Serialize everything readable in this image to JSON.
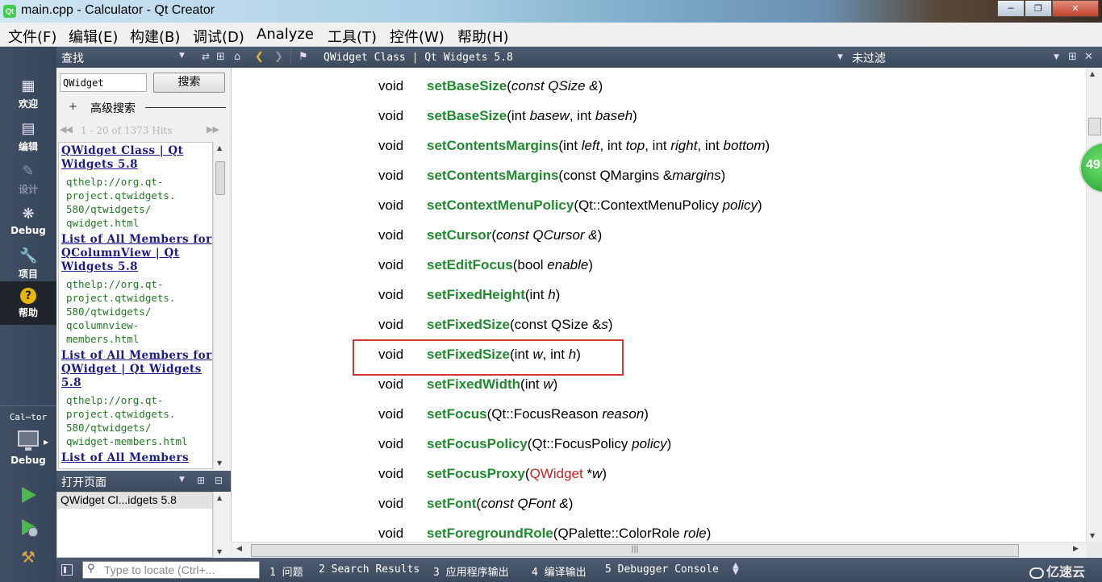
{
  "window": {
    "title": "main.cpp - Calculator - Qt Creator",
    "app_icon": "Qt",
    "min_label": "─",
    "max_label": "❐",
    "close_label": "✕"
  },
  "menubar": {
    "items": [
      "文件(F)",
      "编辑(E)",
      "构建(B)",
      "调试(D)",
      "Analyze",
      "工具(T)",
      "控件(W)",
      "帮助(H)"
    ]
  },
  "modebar": {
    "modes": [
      {
        "label": "欢迎",
        "icon": "grid-icon"
      },
      {
        "label": "编辑",
        "icon": "document-icon"
      },
      {
        "label": "设计",
        "icon": "pencil-icon"
      },
      {
        "label": "Debug",
        "icon": "bug-icon"
      },
      {
        "label": "项目",
        "icon": "wrench-icon"
      },
      {
        "label": "帮助",
        "icon": "help-icon"
      }
    ],
    "active": "帮助",
    "kit_project": "Cal⋯tor",
    "kit_mode": "Debug"
  },
  "find_panel": {
    "title": "查找",
    "search_value": "QWidget",
    "search_button": "搜索",
    "advanced_label": "高级搜索",
    "advanced_toggle": "+",
    "hits_text": "1 - 20 of 1373 Hits",
    "results": [
      {
        "title": "QWidget Class | Qt Widgets 5.8",
        "url": "qthelp://org.qt-\nproject.qtwidgets.\n580/qtwidgets/\nqwidget.html"
      },
      {
        "title": "List of All Members for QColumnView | Qt Widgets 5.8",
        "url": "qthelp://org.qt-\nproject.qtwidgets.\n580/qtwidgets/\nqcolumnview-\nmembers.html"
      },
      {
        "title": "List of All Members for QWidget | Qt Widgets 5.8",
        "url": "qthelp://org.qt-\nproject.qtwidgets.\n580/qtwidgets/\nqwidget-members.html"
      },
      {
        "title": "List of All Members",
        "url": ""
      }
    ]
  },
  "open_pages": {
    "title": "打开页面",
    "items": [
      "QWidget Cl...idgets 5.8"
    ]
  },
  "help_toolbar": {
    "doc_title": "QWidget Class | Qt Widgets 5.8",
    "filter": "未过滤"
  },
  "functions": [
    {
      "ret": "void",
      "name": "setBaseSize",
      "params": [
        [
          "(",
          ""
        ],
        [
          "const QSize &",
          "i"
        ],
        [
          ")",
          ""
        ]
      ]
    },
    {
      "ret": "void",
      "name": "setBaseSize",
      "params": [
        [
          "(int ",
          ""
        ],
        [
          "basew",
          "i"
        ],
        [
          ", int ",
          ""
        ],
        [
          "baseh",
          "i"
        ],
        [
          ")",
          ""
        ]
      ]
    },
    {
      "ret": "void",
      "name": "setContentsMargins",
      "params": [
        [
          "(int ",
          ""
        ],
        [
          "left",
          "i"
        ],
        [
          ", int ",
          ""
        ],
        [
          "top",
          "i"
        ],
        [
          ", int ",
          ""
        ],
        [
          "right",
          "i"
        ],
        [
          ", int ",
          ""
        ],
        [
          "bottom",
          "i"
        ],
        [
          ")",
          ""
        ]
      ]
    },
    {
      "ret": "void",
      "name": "setContentsMargins",
      "params": [
        [
          "(const QMargins &",
          ""
        ],
        [
          "margins",
          "i"
        ],
        [
          ")",
          ""
        ]
      ]
    },
    {
      "ret": "void",
      "name": "setContextMenuPolicy",
      "params": [
        [
          "(Qt::ContextMenuPolicy ",
          ""
        ],
        [
          "policy",
          "i"
        ],
        [
          ")",
          ""
        ]
      ]
    },
    {
      "ret": "void",
      "name": "setCursor",
      "params": [
        [
          "(",
          ""
        ],
        [
          "const QCursor &",
          "i"
        ],
        [
          ")",
          ""
        ]
      ]
    },
    {
      "ret": "void",
      "name": "setEditFocus",
      "params": [
        [
          "(bool ",
          ""
        ],
        [
          "enable",
          "i"
        ],
        [
          ")",
          ""
        ]
      ]
    },
    {
      "ret": "void",
      "name": "setFixedHeight",
      "params": [
        [
          "(int ",
          ""
        ],
        [
          "h",
          "i"
        ],
        [
          ")",
          ""
        ]
      ]
    },
    {
      "ret": "void",
      "name": "setFixedSize",
      "params": [
        [
          "(const QSize &",
          ""
        ],
        [
          "s",
          "i"
        ],
        [
          ")",
          ""
        ]
      ]
    },
    {
      "ret": "void",
      "name": "setFixedSize",
      "params": [
        [
          "(int ",
          ""
        ],
        [
          "w",
          "i"
        ],
        [
          ", int ",
          ""
        ],
        [
          "h",
          "i"
        ],
        [
          ")",
          ""
        ]
      ]
    },
    {
      "ret": "void",
      "name": "setFixedWidth",
      "params": [
        [
          "(int ",
          ""
        ],
        [
          "w",
          "i"
        ],
        [
          ")",
          ""
        ]
      ]
    },
    {
      "ret": "void",
      "name": "setFocus",
      "params": [
        [
          "(Qt::FocusReason ",
          ""
        ],
        [
          "reason",
          "i"
        ],
        [
          ")",
          ""
        ]
      ]
    },
    {
      "ret": "void",
      "name": "setFocusPolicy",
      "params": [
        [
          "(Qt::FocusPolicy ",
          ""
        ],
        [
          "policy",
          "i"
        ],
        [
          ")",
          ""
        ]
      ]
    },
    {
      "ret": "void",
      "name": "setFocusProxy",
      "params": [
        [
          "(",
          ""
        ],
        [
          "QWidget",
          "r"
        ],
        [
          " *",
          ""
        ],
        [
          "w",
          "i"
        ],
        [
          ")",
          ""
        ]
      ]
    },
    {
      "ret": "void",
      "name": "setFont",
      "params": [
        [
          "(",
          ""
        ],
        [
          "const QFont &",
          "i"
        ],
        [
          ")",
          ""
        ]
      ]
    },
    {
      "ret": "void",
      "name": "setForegroundRole",
      "params": [
        [
          "(QPalette::ColorRole ",
          ""
        ],
        [
          "role",
          "i"
        ],
        [
          ")",
          ""
        ]
      ]
    }
  ],
  "highlighted_row": 9,
  "badge_value": "49",
  "statusbar": {
    "locator_placeholder": "Type to locate (Ctrl+...",
    "panes": [
      "1 问题",
      "2 Search Results",
      "3 应用程序输出",
      "4 编译输出",
      "5 Debugger Console"
    ],
    "watermark": "亿速云"
  },
  "colors": {
    "function_name": "#1f8a2e",
    "highlight_border": "#d43535",
    "type_link_red": "#d02020",
    "panel_header": "#3c4a5d",
    "modebar_bg": "#3a4759",
    "result_link": "#1a1a8c",
    "result_url": "#1f7a1f"
  }
}
